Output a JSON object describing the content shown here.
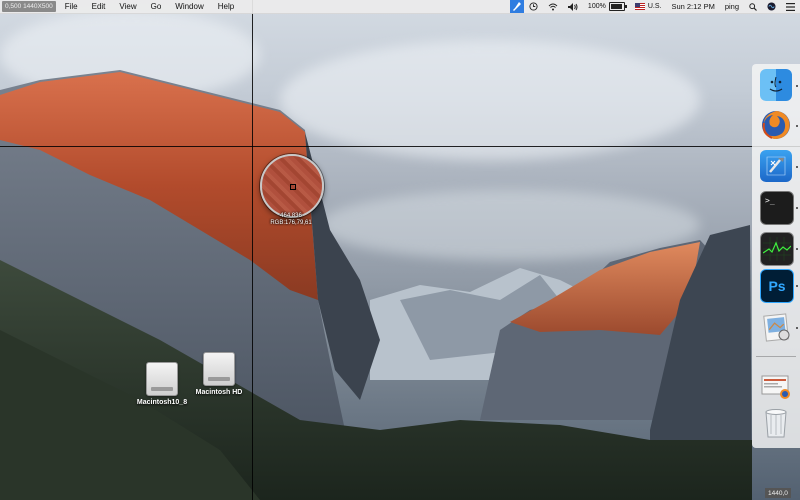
{
  "menubar": {
    "coordinate_readout": "0,500 1440X500",
    "menus": [
      "File",
      "Edit",
      "View",
      "Go",
      "Window",
      "Help"
    ],
    "battery_label": "100%",
    "input_source": "U.S.",
    "clock": "Sun 2:12 PM",
    "user": "ping"
  },
  "magnifier": {
    "position_readout": "464,836",
    "color_readout": "RGB:176,79,61",
    "sampled_color": "#b04f3d"
  },
  "desktop_icons": [
    {
      "label": "Macintosh10_8",
      "icon": "hard-disk-icon"
    },
    {
      "label": "Macintosh HD",
      "icon": "hard-disk-icon"
    }
  ],
  "dock": {
    "apps": [
      {
        "name": "Finder",
        "icon": "finder-icon",
        "running": true
      },
      {
        "name": "Firefox",
        "icon": "firefox-icon",
        "running": true
      },
      {
        "name": "Xcode",
        "icon": "xcode-icon",
        "running": true
      },
      {
        "name": "Terminal",
        "icon": "terminal-icon",
        "running": true
      },
      {
        "name": "Activity Monitor",
        "icon": "activity-monitor-icon",
        "running": true
      },
      {
        "name": "Photoshop",
        "icon": "photoshop-icon",
        "running": true,
        "label": "Ps"
      },
      {
        "name": "Preview",
        "icon": "preview-icon",
        "running": true
      },
      {
        "name": "Downloads stack",
        "icon": "downloads-stack-icon",
        "running": false
      },
      {
        "name": "Trash",
        "icon": "trash-icon",
        "running": false
      }
    ],
    "terminal_prompt": ">_"
  },
  "bottom_coordinate": "1440,0",
  "colors": {
    "menubar_bg": "#ebebeb",
    "picker_accent": "#2f7de1",
    "photoshop_bg": "#001e36",
    "photoshop_text": "#31a8ff"
  }
}
